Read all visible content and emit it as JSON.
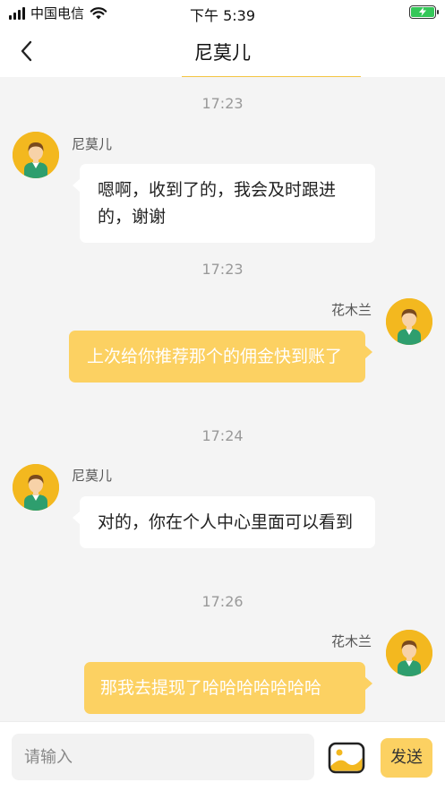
{
  "status_bar": {
    "carrier": "中国电信",
    "time": "下午 5:39"
  },
  "header": {
    "title": "尼莫儿"
  },
  "messages": [
    {
      "time": "17:23",
      "side": "left",
      "name": "尼莫儿",
      "text": "嗯啊，收到了的，我会及时跟进的，谢谢"
    },
    {
      "time": "17:23",
      "side": "right",
      "name": "花木兰",
      "text": "上次给你推荐那个的佣金快到账了"
    },
    {
      "time": "17:24",
      "side": "left",
      "name": "尼莫儿",
      "text": "对的，你在个人中心里面可以看到"
    },
    {
      "time": "17:26",
      "side": "right",
      "name": "花木兰",
      "text": "那我去提现了哈哈哈哈哈哈哈"
    }
  ],
  "input_bar": {
    "placeholder": "请输入",
    "send_label": "发送"
  },
  "colors": {
    "accent": "#fcd162",
    "avatar_bg": "#f3b81f",
    "battery": "#35c759",
    "background": "#f4f4f4"
  },
  "icons": {
    "back": "chevron-left-icon",
    "image": "image-icon",
    "wifi": "wifi-icon",
    "battery": "battery-charging-icon"
  }
}
